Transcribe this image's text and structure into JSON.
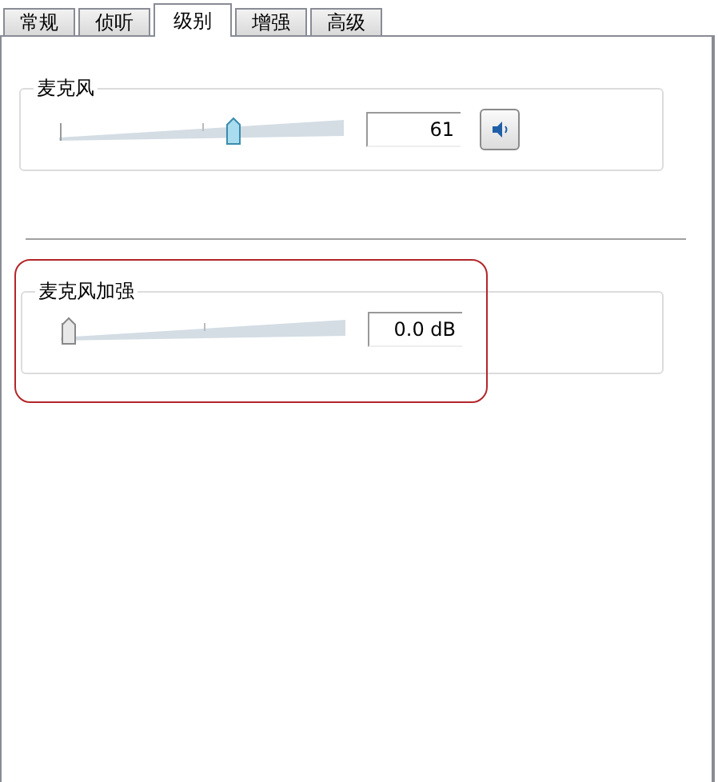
{
  "tabs": [
    {
      "label": "常规",
      "selected": false
    },
    {
      "label": "侦听",
      "selected": false
    },
    {
      "label": "级别",
      "selected": true
    },
    {
      "label": "增强",
      "selected": false
    },
    {
      "label": "高级",
      "selected": false
    }
  ],
  "groups": [
    {
      "title": "麦克风",
      "level": 0.61,
      "reading": "61",
      "mute_button": true,
      "highlighted": false
    },
    {
      "title": "麦克风加强",
      "level": 0,
      "reading": "0.0 dB",
      "mute_button": false,
      "highlighted": true
    }
  ]
}
